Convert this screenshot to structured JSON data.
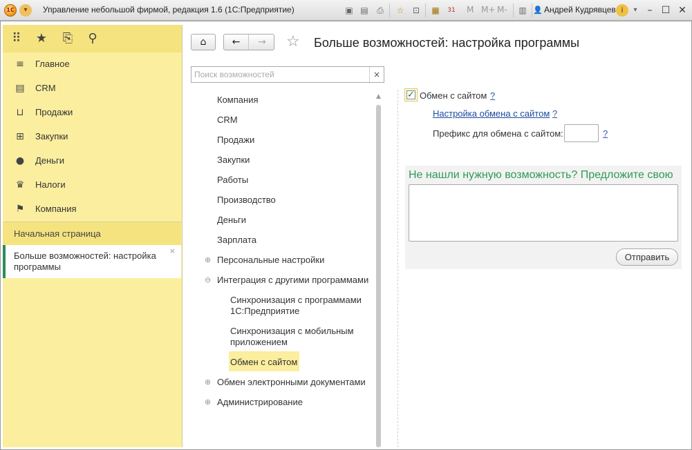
{
  "window": {
    "title": "Управление небольшой фирмой, редакция 1.6  (1С:Предприятие)",
    "user": "Андрей Кудрявцев",
    "logo_text": "1С",
    "toolbar_text_buttons": [
      "M",
      "M+",
      "M-"
    ],
    "calendar_day": "31"
  },
  "sidebar": {
    "sections": [
      {
        "label": "Главное",
        "icon": "menu-lines-icon"
      },
      {
        "label": "CRM",
        "icon": "id-card-icon"
      },
      {
        "label": "Продажи",
        "icon": "basket-icon"
      },
      {
        "label": "Закупки",
        "icon": "cart-icon"
      },
      {
        "label": "Деньги",
        "icon": "ruble-coin-icon"
      },
      {
        "label": "Налоги",
        "icon": "eagle-emblem-icon"
      },
      {
        "label": "Компания",
        "icon": "flag-icon"
      }
    ],
    "start_page": "Начальная страница",
    "open_form": "Больше возможностей: настройка программы"
  },
  "page": {
    "title": "Больше возможностей: настройка программы",
    "search_placeholder": "Поиск возможностей",
    "tree": [
      {
        "label": "Компания",
        "level": 0
      },
      {
        "label": "CRM",
        "level": 0
      },
      {
        "label": "Продажи",
        "level": 0
      },
      {
        "label": "Закупки",
        "level": 0
      },
      {
        "label": "Работы",
        "level": 0
      },
      {
        "label": "Производство",
        "level": 0
      },
      {
        "label": "Деньги",
        "level": 0
      },
      {
        "label": "Зарплата",
        "level": 0
      },
      {
        "label": "Персональные настройки",
        "level": 0,
        "expander": "⊕"
      },
      {
        "label": "Интеграция с другими программами",
        "level": 0,
        "expander": "⊖"
      },
      {
        "label": "Синхронизация с программами 1С:Предприятие",
        "level": 1
      },
      {
        "label": "Синхронизация с мобильным приложением",
        "level": 1
      },
      {
        "label": "Обмен с сайтом",
        "level": 1,
        "selected": true
      },
      {
        "label": "Обмен электронными документами",
        "level": 0,
        "expander": "⊕"
      },
      {
        "label": "Администрирование",
        "level": 0,
        "expander": "⊕"
      }
    ],
    "exchange": {
      "checkbox_label": "Обмен с сайтом",
      "checked": true,
      "help": "?",
      "settings_link": "Настройка обмена с сайтом",
      "prefix_label": "Префикс для обмена с сайтом:",
      "prefix_value": ""
    },
    "suggest": {
      "title": "Не нашли нужную возможность? Предложите свою",
      "text": "",
      "send_label": "Отправить"
    }
  },
  "colors": {
    "sidebar_bg": "#fbee9f",
    "sidebar_header_bg": "#f5e37f",
    "selected_bg": "#fbee9f",
    "accent_green": "#2e9a55",
    "link_blue": "#1d4a9e"
  }
}
